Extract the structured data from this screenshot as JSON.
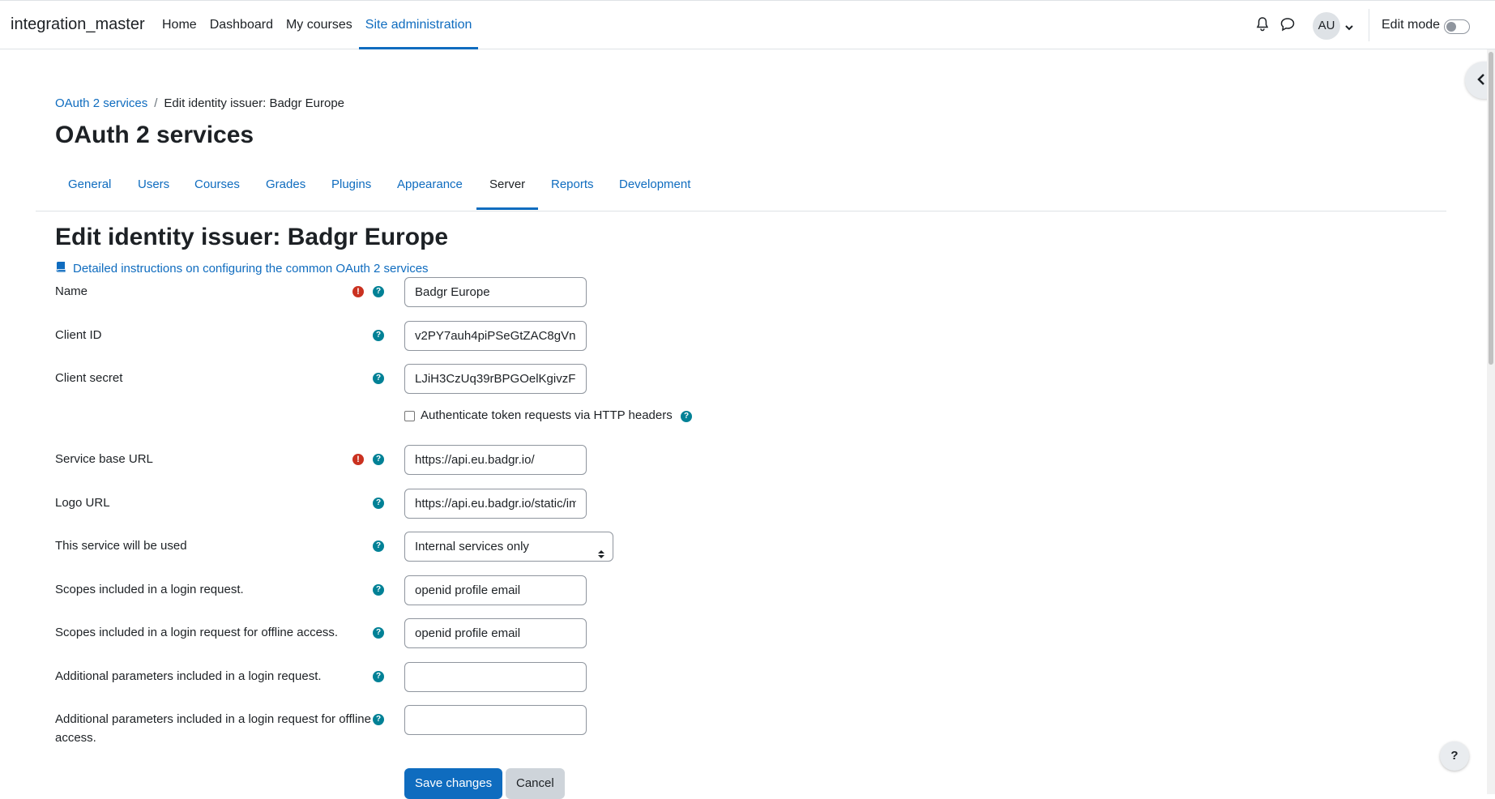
{
  "app": {
    "brand": "integration_master"
  },
  "nav": {
    "home": "Home",
    "dashboard": "Dashboard",
    "my_courses": "My courses",
    "site_admin": "Site administration"
  },
  "user": {
    "initials": "AU"
  },
  "edit_mode": {
    "label": "Edit mode"
  },
  "breadcrumb": {
    "parent": "OAuth 2 services",
    "separator": "/",
    "current": "Edit identity issuer: Badgr Europe"
  },
  "page_title": "OAuth 2 services",
  "tabs": {
    "general": "General",
    "users": "Users",
    "courses": "Courses",
    "grades": "Grades",
    "plugins": "Plugins",
    "appearance": "Appearance",
    "server": "Server",
    "reports": "Reports",
    "development": "Development"
  },
  "form": {
    "title": "Edit identity issuer: Badgr Europe",
    "doc_link": "Detailed instructions on configuring the common OAuth 2 services",
    "name": {
      "label": "Name",
      "value": "Badgr Europe"
    },
    "client_id": {
      "label": "Client ID",
      "value": "v2PY7auh4piPSeGtZAC8gVn"
    },
    "client_secret": {
      "label": "Client secret",
      "value": "LJiH3CzUq39rBPGOelKgivzF"
    },
    "auth_headers": {
      "label": "Authenticate token requests via HTTP headers",
      "checked": false
    },
    "base_url": {
      "label": "Service base URL",
      "value": "https://api.eu.badgr.io/"
    },
    "logo_url": {
      "label": "Logo URL",
      "value": "https://api.eu.badgr.io/static/im"
    },
    "used": {
      "label": "This service will be used",
      "value": "Internal services only"
    },
    "scopes": {
      "label": "Scopes included in a login request.",
      "value": "openid profile email"
    },
    "scopes_offline": {
      "label": "Scopes included in a login request for offline access.",
      "value": "openid profile email"
    },
    "params": {
      "label": "Additional parameters included in a login request.",
      "value": ""
    },
    "params_offline": {
      "label": "Additional parameters included in a login request for offline access.",
      "value": ""
    },
    "save": "Save changes",
    "cancel": "Cancel"
  },
  "help_fab": "?",
  "icons": {
    "required": "!",
    "help": "?"
  }
}
